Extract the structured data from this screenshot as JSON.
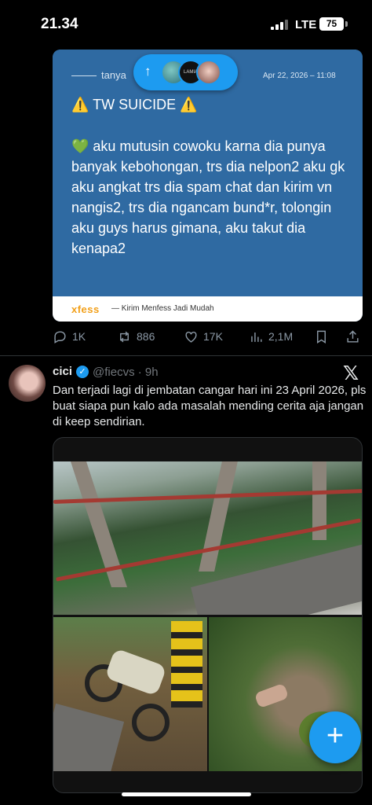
{
  "status_bar": {
    "time": "21.34",
    "network": "LTE",
    "battery": "75"
  },
  "quoted_card": {
    "handle": "tanya",
    "date": "Apr 22, 2026 – 11:08",
    "warning": "⚠️ TW SUICIDE ⚠️",
    "message": "💚 aku mutusin cowoku karna dia punya banyak kebohongan, trs dia nelpon2 aku gk aku angkat trs dia spam chat dan kirim vn nangis2, trs dia ngancam bund*r, tolongin aku guys harus gimana, aku takut dia kenapa2",
    "brand": "xfess",
    "tagline": "Kirim Menfess Jadi Mudah"
  },
  "new_posts_pill": {
    "arrow": "↑",
    "avatar2_text": "LAMIA"
  },
  "tweet1_actions": {
    "replies": "1K",
    "reposts": "886",
    "likes": "17K",
    "views": "2,1M"
  },
  "tweet2": {
    "name": "cici",
    "handle": "@fiecvs · 9h",
    "text": "Dan terjadi lagi di jembatan cangar hari ini 23 April 2026, pls buat siapa pun kalo ada masalah mending cerita aja jangan di keep sendirian.",
    "x_logo": "𝕏"
  },
  "fab": {
    "label": "+"
  },
  "colors": {
    "accent": "#1d9bf0",
    "card_bg": "#2f6aa2",
    "background": "#000000"
  }
}
